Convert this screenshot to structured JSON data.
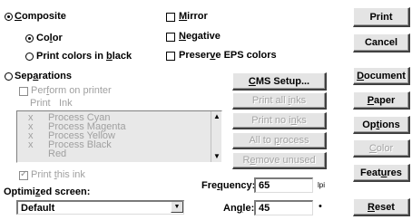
{
  "composite": {
    "label_pre": "",
    "label_u": "C",
    "label_post": "omposite",
    "color": {
      "label_pre": "Co",
      "label_u": "l",
      "label_post": "or"
    },
    "black": {
      "label_pre": "Print colors in ",
      "label_u": "b",
      "label_post": "lack"
    }
  },
  "checks": {
    "mirror": {
      "label_u": "M",
      "label_post": "irror"
    },
    "negative": {
      "label_u": "N",
      "label_post": "egative"
    },
    "preserve": {
      "label_pre": "Preser",
      "label_u": "v",
      "label_post": "e EPS colors"
    }
  },
  "separations": {
    "label_pre": "Sep",
    "label_u": "a",
    "label_post": "rations",
    "perform": {
      "label_pre": "Per",
      "label_u": "f",
      "label_post": "orm on printer"
    },
    "columns": [
      "Print",
      "Ink"
    ],
    "inks": [
      {
        "mark": "x",
        "name": "Process Cyan"
      },
      {
        "mark": "x",
        "name": "Process Magenta"
      },
      {
        "mark": "x",
        "name": "Process Yellow"
      },
      {
        "mark": "x",
        "name": "Process Black"
      },
      {
        "mark": "",
        "name": "Red"
      }
    ],
    "print_this_ink": {
      "label_pre": "Print ",
      "label_u": "t",
      "label_post": "his ink"
    }
  },
  "mid_buttons": {
    "cms": {
      "label_u": "C",
      "label_post": "MS Setup..."
    },
    "print_all": {
      "label_pre": "Print all ",
      "label_u": "i",
      "label_post": "nks"
    },
    "print_no": {
      "label_pre": "Print no i",
      "label_u": "n",
      "label_post": "ks"
    },
    "all_to_process": {
      "label_pre": "All to ",
      "label_u": "p",
      "label_post": "rocess"
    },
    "remove_unused": {
      "label_pre": "R",
      "label_u": "e",
      "label_post": "move unused"
    }
  },
  "screen": {
    "label_pre": "Optimi",
    "label_u": "z",
    "label_post": "ed screen:",
    "value": "Default"
  },
  "frequency": {
    "label_pre": "Fre",
    "label_u": "q",
    "label_post": "uency:",
    "value": "65",
    "unit": "lpi"
  },
  "angle": {
    "label_pre": "An",
    "label_u": "g",
    "label_post": "le:",
    "value": "45",
    "unit": "•"
  },
  "right_buttons": {
    "print": "Print",
    "cancel": "Cancel",
    "document": {
      "label_u": "D",
      "label_post": "ocument"
    },
    "paper": {
      "label_u": "P",
      "label_post": "aper"
    },
    "options": {
      "label_pre": "Op",
      "label_u": "t",
      "label_post": "ions"
    },
    "color": {
      "label_u": "C",
      "label_post": "olor"
    },
    "features": {
      "label_pre": "Feat",
      "label_u": "u",
      "label_post": "res"
    },
    "reset": {
      "label_u": "R",
      "label_post": "eset"
    }
  }
}
